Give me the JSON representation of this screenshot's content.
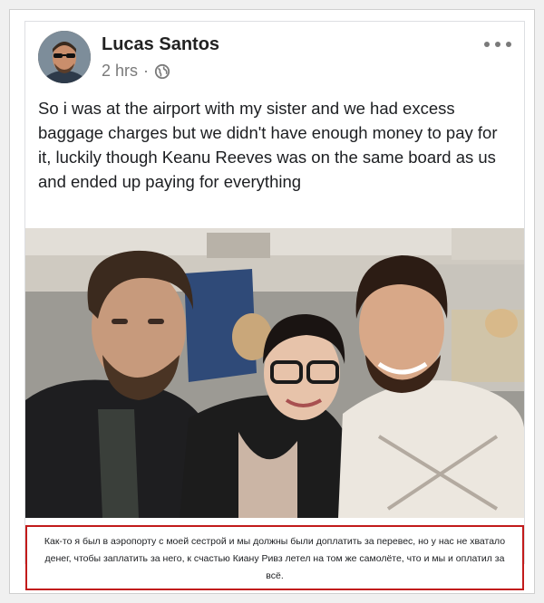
{
  "post": {
    "author": "Lucas Santos",
    "time": "2 hrs",
    "separator": "·",
    "privacy_icon": "globe-icon",
    "menu_icon": "more-options-icon",
    "text": "So i was at the airport with my sister and we had excess baggage charges but we didn't have enough money to pay for it, luckily though Keanu Reeves was on the same board as us and ended up paying for everything"
  },
  "caption": {
    "text": "Как-то я был в аэропорту с моей сестрой и мы должны были доплатить за перевес, но у нас не хватало денег, чтобы заплатить за него, к счастью Киану Ривз летел на том же самолёте, что и мы и оплатил за всё.",
    "border_color": "#c21b1b"
  }
}
